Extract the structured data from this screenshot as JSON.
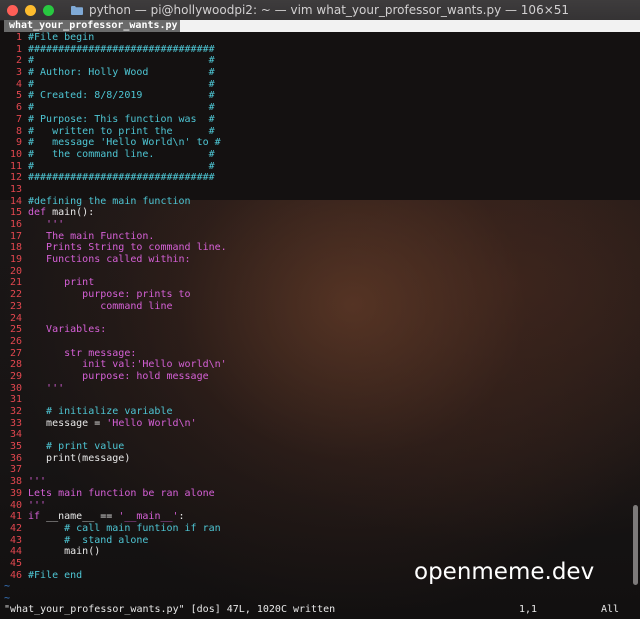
{
  "window": {
    "title": "python — pi@hollywoodpi2: ~ — vim what_your_professor_wants.py — 106×51"
  },
  "tab": {
    "label": " what_your_professor_wants.py "
  },
  "editor": {
    "lines": [
      {
        "n": "1",
        "segments": [
          {
            "t": "#File begin",
            "c": "comment"
          }
        ]
      },
      {
        "n": "1",
        "segments": [
          {
            "t": "###############################",
            "c": "comment"
          }
        ]
      },
      {
        "n": "2",
        "segments": [
          {
            "t": "#                             #",
            "c": "comment"
          }
        ]
      },
      {
        "n": "3",
        "segments": [
          {
            "t": "# Author: Holly Wood          #",
            "c": "comment"
          }
        ]
      },
      {
        "n": "4",
        "segments": [
          {
            "t": "#                             #",
            "c": "comment"
          }
        ]
      },
      {
        "n": "5",
        "segments": [
          {
            "t": "# Created: 8/8/2019           #",
            "c": "comment"
          }
        ]
      },
      {
        "n": "6",
        "segments": [
          {
            "t": "#                             #",
            "c": "comment"
          }
        ]
      },
      {
        "n": "7",
        "segments": [
          {
            "t": "# Purpose: This function was  #",
            "c": "comment"
          }
        ]
      },
      {
        "n": "8",
        "segments": [
          {
            "t": "#   written to print the      #",
            "c": "comment"
          }
        ]
      },
      {
        "n": "9",
        "segments": [
          {
            "t": "#   message 'Hello World\\n' to #",
            "c": "comment"
          }
        ]
      },
      {
        "n": "10",
        "segments": [
          {
            "t": "#   the command line.         #",
            "c": "comment"
          }
        ]
      },
      {
        "n": "11",
        "segments": [
          {
            "t": "#                             #",
            "c": "comment"
          }
        ]
      },
      {
        "n": "12",
        "segments": [
          {
            "t": "###############################",
            "c": "comment"
          }
        ]
      },
      {
        "n": "13",
        "segments": []
      },
      {
        "n": "14",
        "segments": [
          {
            "t": "#defining the main function",
            "c": "comment"
          }
        ]
      },
      {
        "n": "15",
        "segments": [
          {
            "t": "def",
            "c": "kw"
          },
          {
            "t": " main():",
            "c": "text"
          }
        ]
      },
      {
        "n": "16",
        "segments": [
          {
            "t": "   '''",
            "c": "str"
          }
        ]
      },
      {
        "n": "17",
        "segments": [
          {
            "t": "   The main Function.",
            "c": "str"
          }
        ]
      },
      {
        "n": "18",
        "segments": [
          {
            "t": "   Prints String to command line.",
            "c": "str"
          }
        ]
      },
      {
        "n": "19",
        "segments": [
          {
            "t": "   Functions called within:",
            "c": "str"
          }
        ]
      },
      {
        "n": "20",
        "segments": []
      },
      {
        "n": "21",
        "segments": [
          {
            "t": "      print",
            "c": "str"
          }
        ]
      },
      {
        "n": "22",
        "segments": [
          {
            "t": "         purpose: prints to",
            "c": "str"
          }
        ]
      },
      {
        "n": "23",
        "segments": [
          {
            "t": "            command line",
            "c": "str"
          }
        ]
      },
      {
        "n": "24",
        "segments": []
      },
      {
        "n": "25",
        "segments": [
          {
            "t": "   Variables:",
            "c": "str"
          }
        ]
      },
      {
        "n": "26",
        "segments": []
      },
      {
        "n": "27",
        "segments": [
          {
            "t": "      str message:",
            "c": "str"
          }
        ]
      },
      {
        "n": "28",
        "segments": [
          {
            "t": "         init val:'Hello world\\n'",
            "c": "str"
          }
        ]
      },
      {
        "n": "29",
        "segments": [
          {
            "t": "         purpose: hold message",
            "c": "str"
          }
        ]
      },
      {
        "n": "30",
        "segments": [
          {
            "t": "   '''",
            "c": "str"
          }
        ]
      },
      {
        "n": "31",
        "segments": []
      },
      {
        "n": "32",
        "segments": [
          {
            "t": "   # initialize variable",
            "c": "comment"
          }
        ]
      },
      {
        "n": "33",
        "segments": [
          {
            "t": "   message = ",
            "c": "text"
          },
          {
            "t": "'Hello World\\n'",
            "c": "str"
          }
        ]
      },
      {
        "n": "34",
        "segments": []
      },
      {
        "n": "35",
        "segments": [
          {
            "t": "   # print value",
            "c": "comment"
          }
        ]
      },
      {
        "n": "36",
        "segments": [
          {
            "t": "   print(message)",
            "c": "text"
          }
        ]
      },
      {
        "n": "37",
        "segments": []
      },
      {
        "n": "38",
        "segments": [
          {
            "t": "'''",
            "c": "str"
          }
        ]
      },
      {
        "n": "39",
        "segments": [
          {
            "t": "Lets main function be ran alone",
            "c": "str"
          }
        ]
      },
      {
        "n": "40",
        "segments": [
          {
            "t": "'''",
            "c": "str"
          }
        ]
      },
      {
        "n": "41",
        "segments": [
          {
            "t": "if",
            "c": "kw"
          },
          {
            "t": " __name__ == ",
            "c": "text"
          },
          {
            "t": "'__main__'",
            "c": "str"
          },
          {
            "t": ":",
            "c": "text"
          }
        ]
      },
      {
        "n": "42",
        "segments": [
          {
            "t": "      # call main funtion if ran",
            "c": "comment"
          }
        ]
      },
      {
        "n": "43",
        "segments": [
          {
            "t": "      #  stand alone",
            "c": "comment"
          }
        ]
      },
      {
        "n": "44",
        "segments": [
          {
            "t": "      main()",
            "c": "text"
          }
        ]
      },
      {
        "n": "45",
        "segments": []
      },
      {
        "n": "46",
        "segments": [
          {
            "t": "#File end",
            "c": "comment"
          }
        ]
      }
    ],
    "tildes": [
      "~",
      "~"
    ]
  },
  "statusline": {
    "message": "\"what_your_professor_wants.py\" [dos] 47L, 1020C written",
    "position": "1,1",
    "scroll": "All"
  },
  "watermark": "openmeme.dev",
  "colors": {
    "line_number": "#e2474f",
    "comment": "#4ec5d3",
    "keyword_string": "#d560d6",
    "text": "#e8e8e8",
    "tilde": "#3a7fd0"
  }
}
